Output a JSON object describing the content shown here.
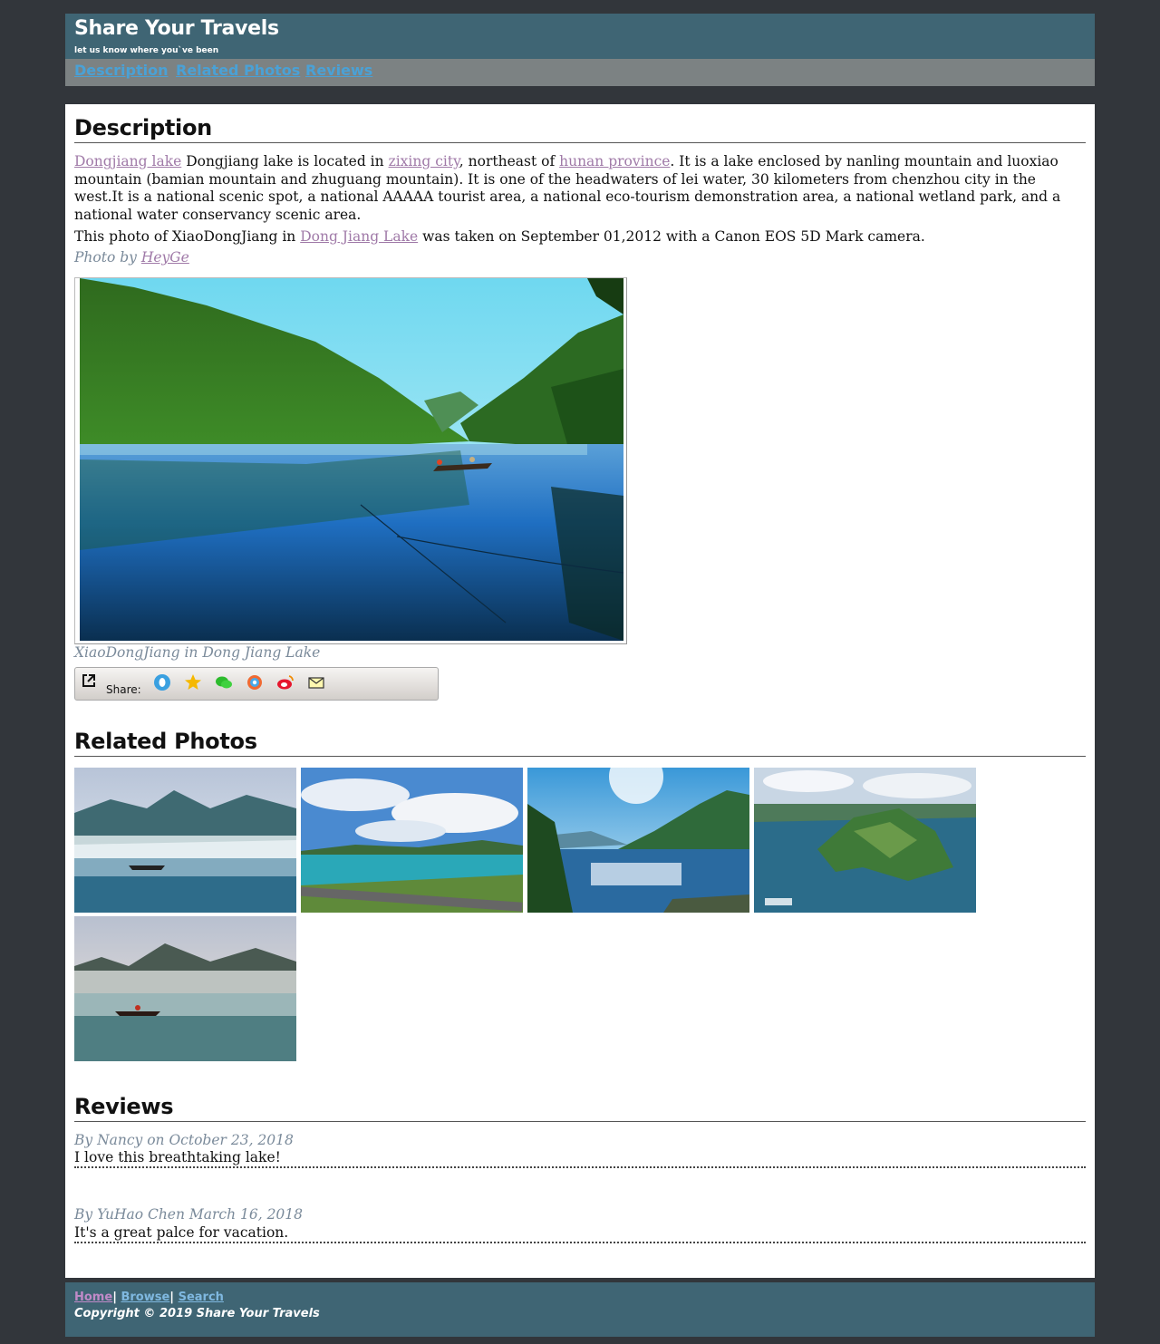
{
  "header": {
    "title": "Share Your Travels",
    "tagline": "let us know where you`ve been"
  },
  "nav": {
    "items": [
      "Description",
      "Related Photos",
      "Reviews"
    ]
  },
  "description": {
    "heading": "Description",
    "para1": {
      "link1": "Dongjiang lake",
      "text1": " Dongjiang lake is located in ",
      "link2": "zixing city",
      "text2": ", northeast of ",
      "link3": "hunan province",
      "text3": ". It is a lake enclosed by nanling mountain and luoxiao mountain (bamian mountain and zhuguang mountain). It is one of the headwaters of lei water, 30 kilometers from chenzhou city in the west.It is a national scenic spot, a national AAAAA tourist area, a national eco-tourism demonstration area, a national wetland park, and a national water conservancy scenic area."
    },
    "para2": {
      "text1": "This photo of XiaoDongJiang in ",
      "link": "Dong Jiang Lake",
      "text2": " was taken on September 01,2012 with a Canon EOS 5D Mark camera."
    },
    "credit_prefix": "Photo by ",
    "credit_author": "HeyGe",
    "caption": "XiaoDongJiang in Dong Jiang Lake",
    "share_label": "Share:",
    "share_icons": [
      "qq-icon",
      "qzone-star-icon",
      "wechat-icon",
      "pengyou-icon",
      "weibo-icon",
      "email-icon"
    ]
  },
  "related": {
    "heading": "Related Photos",
    "photos": [
      "misty-lake-boat",
      "lake-shore-clouds",
      "sunlit-lake-valley",
      "aerial-island",
      "foggy-lake-boat"
    ]
  },
  "reviews": {
    "heading": "Reviews",
    "items": [
      {
        "meta": "By Nancy on October 23, 2018",
        "text": "I love this breathtaking lake!"
      },
      {
        "meta": "By YuHao Chen March 16, 2018",
        "text": "It's a great palce for vacation."
      }
    ]
  },
  "footer": {
    "links": [
      "Home",
      "Browse",
      "Search"
    ],
    "separator": "|",
    "copyright": "Copyright © 2019 Share Your Travels"
  },
  "colors": {
    "page_bg": "#32363b",
    "header_bg": "#3f6574",
    "nav_bg": "#7c8283",
    "nav_link": "#4aa1d6",
    "visited_link": "#a07aa8",
    "meta_text": "#7a8a9a"
  }
}
